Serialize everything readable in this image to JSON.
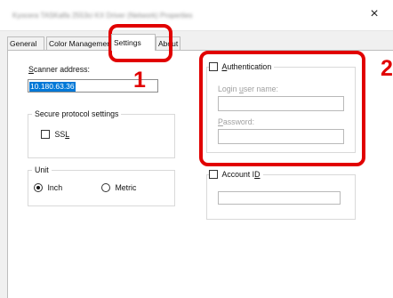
{
  "window": {
    "title": "Kyocera TASKalfa 2553ci KX Driver (Network) Properties",
    "close_glyph": "×"
  },
  "tabs": [
    {
      "label": "General"
    },
    {
      "label": "Color Management"
    },
    {
      "label": "Settings"
    },
    {
      "label": "About"
    }
  ],
  "scanner": {
    "label_first": "S",
    "label_rest": "canner address:",
    "value": "10.180.63.36"
  },
  "secure": {
    "legend": "Secure protocol settings",
    "ssl_label_main": "SS",
    "ssl_label_underlined": "L"
  },
  "unit": {
    "legend": "Unit",
    "inch_label": "Inch",
    "metric_label": "Metric",
    "selected": "Inch"
  },
  "auth": {
    "label_first": "A",
    "label_rest": "uthentication",
    "login_label_a": "Login ",
    "login_label_u": "u",
    "login_label_b": "ser name:",
    "password_label_first": "P",
    "password_label_rest": "assword:",
    "checked": false
  },
  "account": {
    "label_main": "Account I",
    "label_underlined": "D",
    "checked": false
  },
  "callouts": {
    "one": "1",
    "two": "2",
    "color": "#e10000"
  }
}
